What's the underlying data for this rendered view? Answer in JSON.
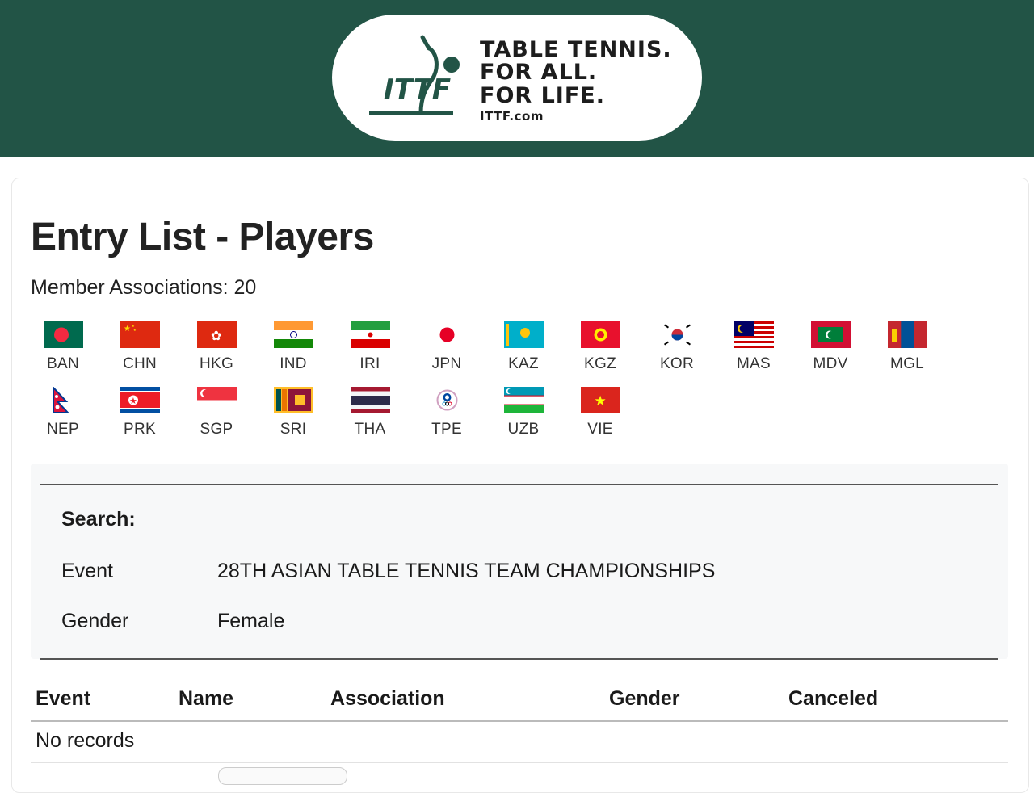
{
  "header": {
    "logo_mark": "ITTF",
    "logo_lines": [
      "TABLE TENNIS.",
      "FOR ALL.",
      "FOR LIFE."
    ],
    "logo_url": "ITTF.com",
    "banner_color": "#225446"
  },
  "page": {
    "title": "Entry List - Players",
    "member_associations_label": "Member Associations: 20"
  },
  "flags": [
    {
      "code": "BAN",
      "icon": "bangladesh-flag-icon"
    },
    {
      "code": "CHN",
      "icon": "china-flag-icon"
    },
    {
      "code": "HKG",
      "icon": "hong-kong-flag-icon"
    },
    {
      "code": "IND",
      "icon": "india-flag-icon"
    },
    {
      "code": "IRI",
      "icon": "iran-flag-icon"
    },
    {
      "code": "JPN",
      "icon": "japan-flag-icon"
    },
    {
      "code": "KAZ",
      "icon": "kazakhstan-flag-icon"
    },
    {
      "code": "KGZ",
      "icon": "kyrgyzstan-flag-icon"
    },
    {
      "code": "KOR",
      "icon": "korea-flag-icon"
    },
    {
      "code": "MAS",
      "icon": "malaysia-flag-icon"
    },
    {
      "code": "MDV",
      "icon": "maldives-flag-icon"
    },
    {
      "code": "MGL",
      "icon": "mongolia-flag-icon"
    },
    {
      "code": "NEP",
      "icon": "nepal-flag-icon"
    },
    {
      "code": "PRK",
      "icon": "dpr-korea-flag-icon"
    },
    {
      "code": "SGP",
      "icon": "singapore-flag-icon"
    },
    {
      "code": "SRI",
      "icon": "sri-lanka-flag-icon"
    },
    {
      "code": "THA",
      "icon": "thailand-flag-icon"
    },
    {
      "code": "TPE",
      "icon": "chinese-taipei-flag-icon"
    },
    {
      "code": "UZB",
      "icon": "uzbekistan-flag-icon"
    },
    {
      "code": "VIE",
      "icon": "vietnam-flag-icon"
    }
  ],
  "search": {
    "title": "Search:",
    "event_label": "Event",
    "event_value": "28TH ASIAN TABLE TENNIS TEAM CHAMPIONSHIPS",
    "gender_label": "Gender",
    "gender_value": "Female"
  },
  "table": {
    "columns": [
      "Event",
      "Name",
      "Association",
      "Gender",
      "Canceled"
    ],
    "empty_text": "No records"
  }
}
